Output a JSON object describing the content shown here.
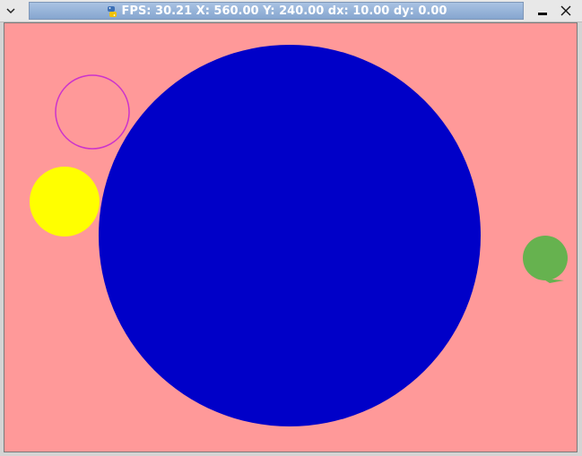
{
  "window": {
    "title": "FPS: 30.21 X: 560.00 Y: 240.00 dx: 10.00 dy: 0.00",
    "icons": {
      "menu": "chevron-down-icon",
      "app": "python-icon",
      "minimize": "minimize-icon",
      "close": "close-icon"
    }
  },
  "scene": {
    "background_color": "#ff9999",
    "circles": [
      {
        "name": "blue-circle",
        "color": "#0000c8",
        "filled": true
      },
      {
        "name": "magenta-ring",
        "color": "#cc33cc",
        "filled": false
      },
      {
        "name": "yellow-circle",
        "color": "#ffff00",
        "filled": true
      },
      {
        "name": "green-circle",
        "color": "#66b24f",
        "filled": true
      }
    ]
  }
}
